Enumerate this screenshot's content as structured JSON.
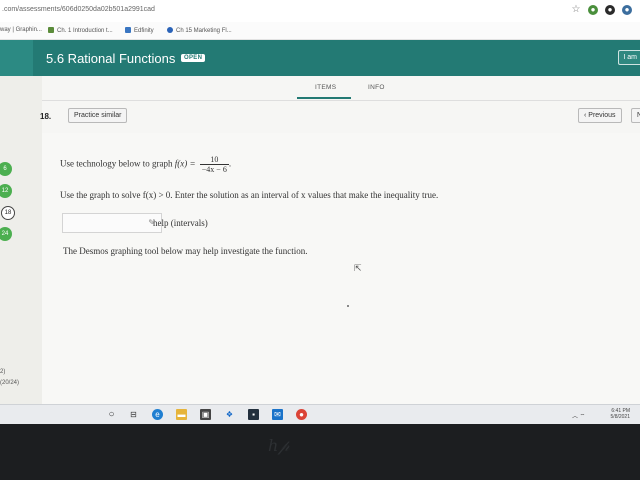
{
  "browser": {
    "url": ".com/assessments/606d0250da02b501a2991cad",
    "bookmarks": [
      {
        "label": "way | Graphin..."
      },
      {
        "label": "Ch. 1 Introduction t..."
      },
      {
        "label": "Edfinity"
      },
      {
        "label": "Ch 15 Marketing Fl..."
      }
    ]
  },
  "header": {
    "title": "5.6 Rational Functions",
    "badge": "OPEN",
    "user_button": "I am"
  },
  "sidebar": {
    "questions": [
      {
        "label": "6"
      },
      {
        "label": "12"
      },
      {
        "label": "18"
      },
      {
        "label": "24"
      }
    ],
    "score_line1": "2)",
    "score_line2": "(20/24)"
  },
  "tabs": [
    {
      "label": "ITEMS"
    },
    {
      "label": "INFO"
    }
  ],
  "question": {
    "number": "18.",
    "practice_button": "Practice similar",
    "previous_button": "Previous",
    "next_button": "N",
    "prompt_lead": "Use technology below to graph",
    "function_lhs": "f(x) =",
    "frac_num": "10",
    "frac_den": "−4x − 6",
    "prompt_end": ".",
    "instruction": "Use the graph to solve f(x) > 0. Enter the solution as an interval of x values that make the inequality true.",
    "help_text": "help (intervals)",
    "desmos_note": "The Desmos graphing tool below may help investigate the function."
  },
  "taskbar": {
    "time": "6:41 PM",
    "date": "5/8/2021"
  },
  "colors": {
    "header": "#237a74",
    "green_badge": "#4caf50"
  }
}
